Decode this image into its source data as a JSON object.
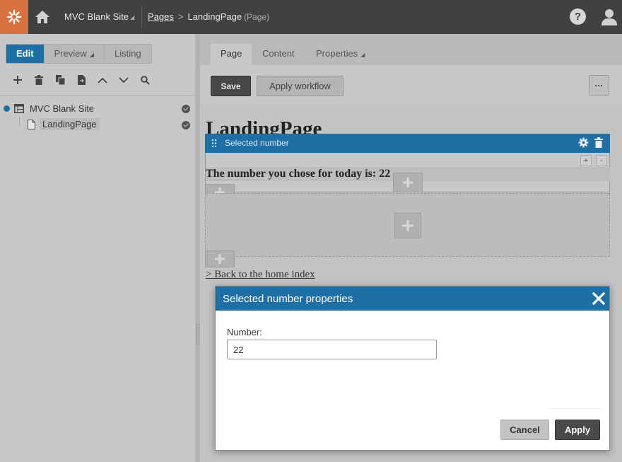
{
  "header": {
    "site_name": "MVC Blank Site",
    "breadcrumb": {
      "root": "Pages",
      "page": "LandingPage",
      "type": "(Page)"
    }
  },
  "mode_tabs": [
    {
      "label": "Edit"
    },
    {
      "label": "Preview"
    },
    {
      "label": "Listing"
    }
  ],
  "tree": [
    {
      "label": "MVC Blank Site"
    },
    {
      "label": "LandingPage"
    }
  ],
  "page_tabs": [
    {
      "label": "Page"
    },
    {
      "label": "Content"
    },
    {
      "label": "Properties"
    }
  ],
  "actions": {
    "save": "Save",
    "workflow": "Apply workflow",
    "more": "···"
  },
  "page": {
    "heading": "LandingPage",
    "widget_title": "Selected number",
    "widget_text": "The number you chose for today is: 22",
    "back_link": "> Back to the home index",
    "ctrl_plus": "+",
    "ctrl_minus": "-"
  },
  "dialog": {
    "title": "Selected number properties",
    "field_label": "Number:",
    "field_value": "22",
    "cancel": "Cancel",
    "apply": "Apply"
  },
  "colors": {
    "accent": "#1d6fa5",
    "logo": "#d8703f",
    "topbar": "#414141"
  }
}
